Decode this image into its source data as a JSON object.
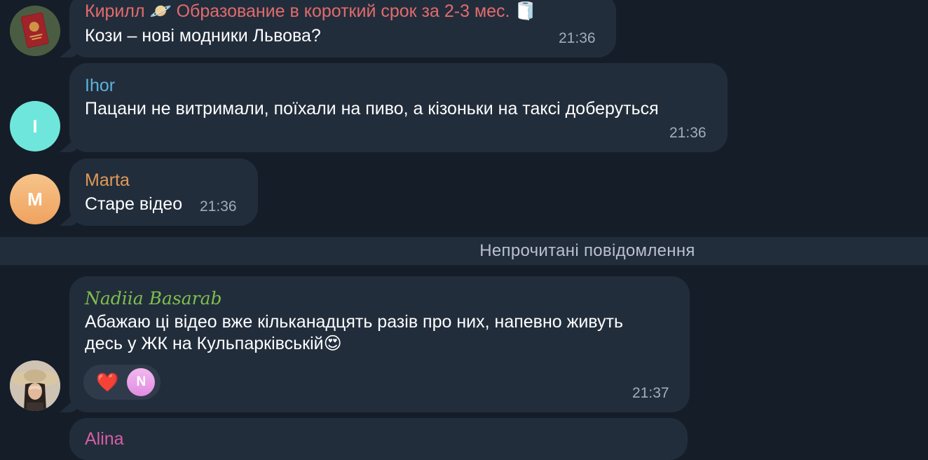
{
  "messages": [
    {
      "sender": "Кирилл 🪐 Образование в короткий срок за 2-3 мес. 🧻",
      "sender_color": "#e36b6b",
      "text": "Кози – нові модники Львова?",
      "time": "21:36",
      "avatar_icon": "passport-photo-avatar"
    },
    {
      "sender": "Ihor",
      "sender_color": "#5ab3d8",
      "text": "Пацани не витримали, поїхали на пиво, а кізоньки на таксі доберуться",
      "time": "21:36",
      "avatar_letter": "I",
      "avatar_color": "#6fe6dc"
    },
    {
      "sender": "Marta",
      "sender_color": "#e09a55",
      "text": "Старе відео",
      "time": "21:36",
      "avatar_letter": "M",
      "avatar_color": "#f5b06a"
    },
    {
      "sender": "Nadiia Basarab",
      "sender_color": "#7fbf4d",
      "text_line1": "Абажаю ці відео вже кільканадцять разів про них, напевно живуть",
      "text_line2": "десь у ЖК на Кульпарківській😍",
      "time": "21:37",
      "reactions": {
        "emoji": "❤️",
        "reactor_letter": "N"
      },
      "avatar_icon": "woman-hat-photo-avatar"
    },
    {
      "sender": "Alina",
      "sender_color": "#d65fa5"
    }
  ],
  "divider": {
    "label": "Непрочитані повідомлення"
  }
}
